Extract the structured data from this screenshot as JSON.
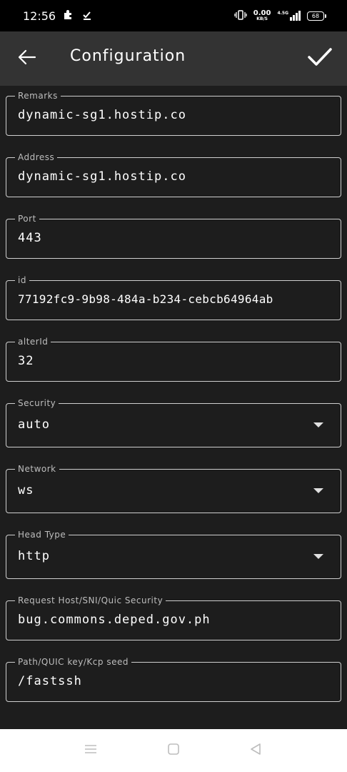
{
  "status_bar": {
    "time": "12:56",
    "net_speed_value": "0.00",
    "net_speed_unit": "KB/S",
    "network_type": "4.5G",
    "battery": "68"
  },
  "app_bar": {
    "title": "Configuration"
  },
  "fields": {
    "remarks": {
      "label": "Remarks",
      "value": "dynamic-sg1.hostip.co"
    },
    "address": {
      "label": "Address",
      "value": "dynamic-sg1.hostip.co"
    },
    "port": {
      "label": "Port",
      "value": "443"
    },
    "id": {
      "label": "id",
      "value": "77192fc9-9b98-484a-b234-cebcb64964ab"
    },
    "alter_id": {
      "label": "alterId",
      "value": "32"
    },
    "security": {
      "label": "Security",
      "value": "auto"
    },
    "network": {
      "label": "Network",
      "value": "ws"
    },
    "head_type": {
      "label": "Head Type",
      "value": "http"
    },
    "request_host": {
      "label": "Request Host/SNI/Quic Security",
      "value": "bug.commons.deped.gov.ph"
    },
    "path": {
      "label": "Path/QUIC key/Kcp seed",
      "value": "/fastssh"
    }
  },
  "icons": {
    "back": "arrow-back-icon",
    "confirm": "check-icon",
    "dropdown": "dropdown-arrow-icon",
    "nav_menu": "menu-icon",
    "nav_home": "home-square-icon",
    "nav_back": "back-triangle-icon"
  },
  "colors": {
    "background": "#1d1d1d",
    "app_bar": "#333333",
    "status_bar": "#000000",
    "field_border": "#cfcfcf",
    "nav_bar": "#ffffff"
  }
}
